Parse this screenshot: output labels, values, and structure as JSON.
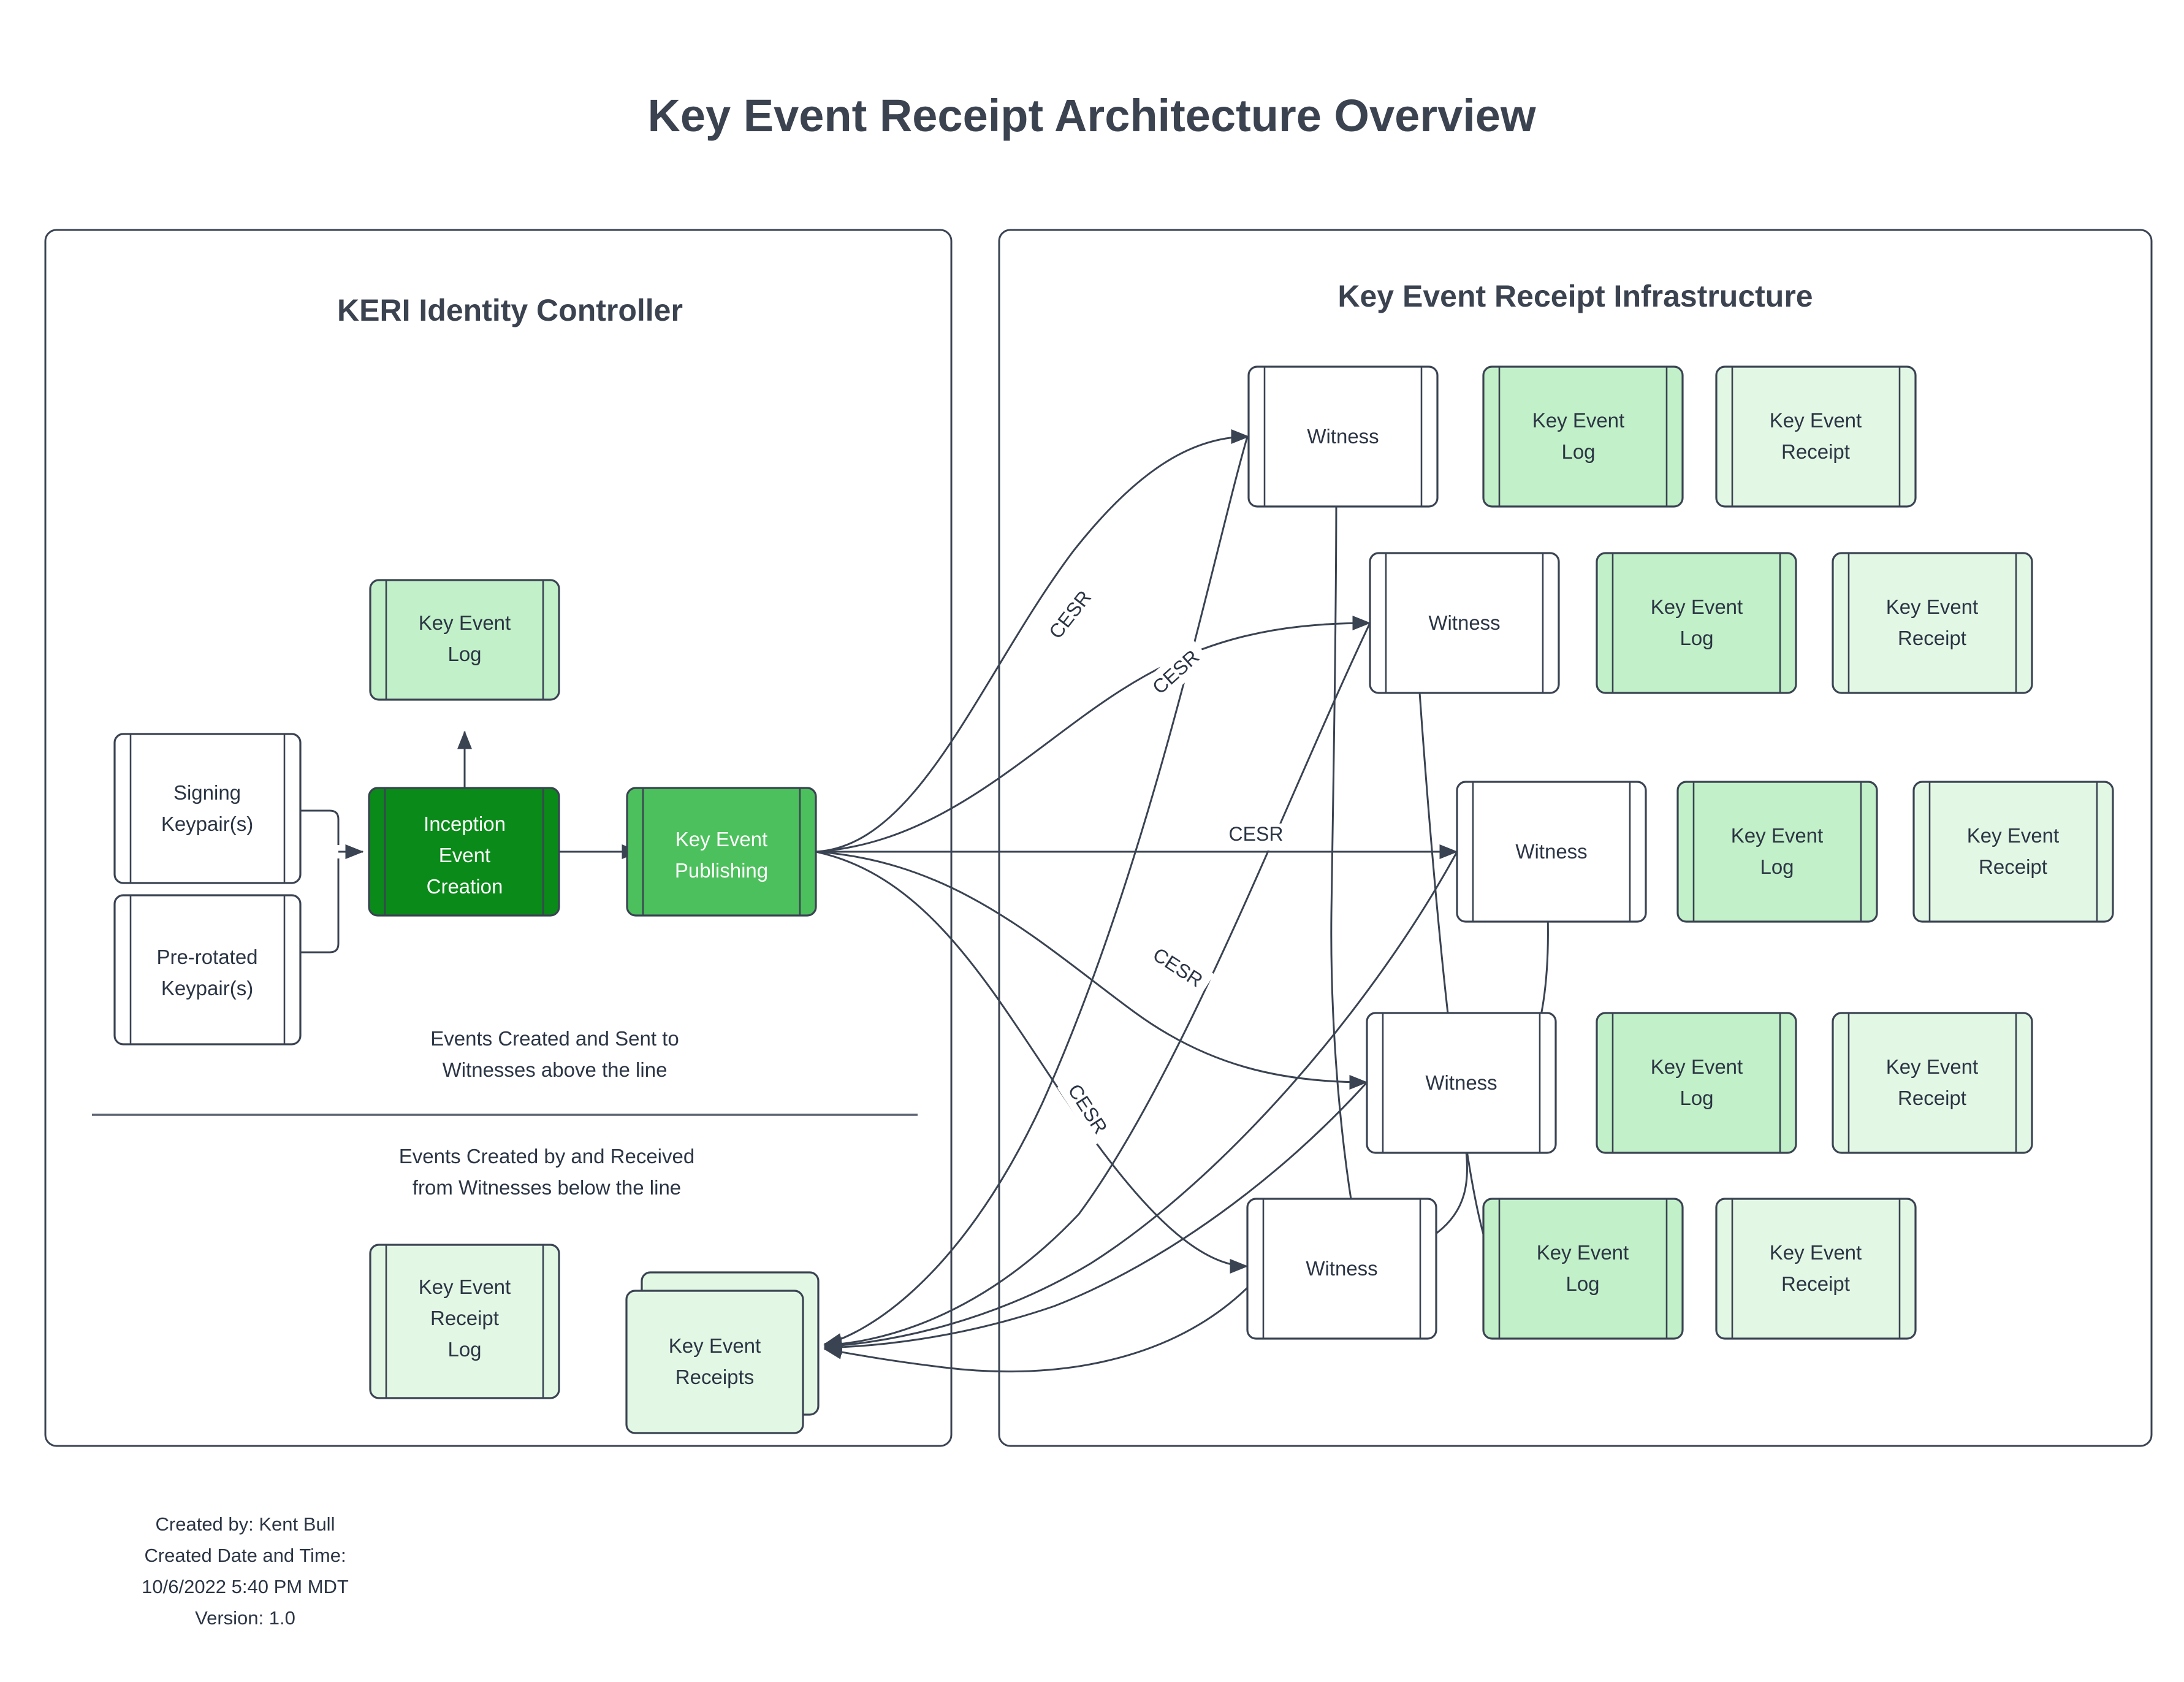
{
  "title": "Key Event Receipt Architecture Overview",
  "panels": {
    "left": {
      "title": "KERI Identity Controller",
      "nodes": {
        "key_event_log": "Key Event Log",
        "signing_keypair": "Signing Keypair(s)",
        "prerotated_keypair": "Pre-rotated Keypair(s)",
        "inception_event_creation": "Inception Event Creation",
        "key_event_publishing": "Key Event Publishing",
        "key_event_receipt_log": "Key Event Receipt Log",
        "key_event_receipts": "Key Event Receipts"
      },
      "notes": {
        "above_line_1": "Events Created and Sent to",
        "above_line_2": "Witnesses above the line",
        "below_line_1": "Events Created by and Received",
        "below_line_2": "from Witnesses below the line"
      }
    },
    "right": {
      "title": "Key Event Receipt Infrastructure",
      "witness_label": "Witness",
      "kel_label": "Key Event Log",
      "ker_label": "Key Event Receipt",
      "rows": [
        {
          "witness": "Witness",
          "kel": "Key Event Log",
          "ker": "Key Event Receipt"
        },
        {
          "witness": "Witness",
          "kel": "Key Event Log",
          "ker": "Key Event Receipt"
        },
        {
          "witness": "Witness",
          "kel": "Key Event Log",
          "ker": "Key Event Receipt"
        },
        {
          "witness": "Witness",
          "kel": "Key Event Log",
          "ker": "Key Event Receipt"
        },
        {
          "witness": "Witness",
          "kel": "Key Event Log",
          "ker": "Key Event Receipt"
        }
      ]
    }
  },
  "edge_labels": {
    "cesr_1": "CESR",
    "cesr_2": "CESR",
    "cesr_3": "CESR",
    "cesr_4": "CESR",
    "cesr_5": "CESR"
  },
  "footer": {
    "line1": "Created by: Kent Bull",
    "line2": "Created Date and Time:",
    "line3": "10/6/2022 5:40 PM MDT",
    "line4": "Version: 1.0"
  },
  "colors": {
    "dark_green": "#0a8a19",
    "mid_green": "#4cc05c",
    "kel_green": "#c2f0c8",
    "ker_green": "#e3f7e5",
    "white": "#ffffff",
    "stroke": "#3a4352",
    "text": "#2b3544"
  }
}
